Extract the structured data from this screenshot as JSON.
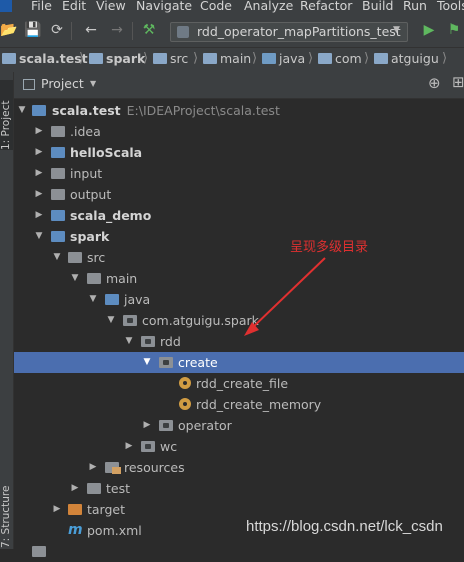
{
  "menu": [
    "File",
    "Edit",
    "View",
    "Navigate",
    "Code",
    "Analyze",
    "Refactor",
    "Build",
    "Run",
    "Tools"
  ],
  "toolbar": {
    "run_config": "rdd_operator_mapPartitions_test"
  },
  "breadcrumb": [
    "scala.test",
    "spark",
    "src",
    "main",
    "java",
    "com",
    "atguigu"
  ],
  "left_strip": {
    "project_tab": "1: Project",
    "structure_tab": "7: Structure"
  },
  "panel": {
    "title": "Project"
  },
  "tree": [
    {
      "label": "scala.test",
      "path": "E:\\IDEAProject\\scala.test"
    },
    {
      "label": ".idea"
    },
    {
      "label": "helloScala"
    },
    {
      "label": "input"
    },
    {
      "label": "output"
    },
    {
      "label": "scala_demo"
    },
    {
      "label": "spark"
    },
    {
      "label": "src"
    },
    {
      "label": "main"
    },
    {
      "label": "java"
    },
    {
      "label": "com.atguigu.spark"
    },
    {
      "label": "rdd"
    },
    {
      "label": "create"
    },
    {
      "label": "rdd_create_file"
    },
    {
      "label": "rdd_create_memory"
    },
    {
      "label": "operator"
    },
    {
      "label": "wc"
    },
    {
      "label": "resources"
    },
    {
      "label": "test"
    },
    {
      "label": "target"
    },
    {
      "label": "pom.xml"
    }
  ],
  "annotation": "呈现多级目录",
  "watermark": "https://blog.csdn.net/lck_csdn",
  "colors": {
    "selection": "#4b6eaf",
    "annotation": "#e03030",
    "background": "#2b2b2b"
  }
}
